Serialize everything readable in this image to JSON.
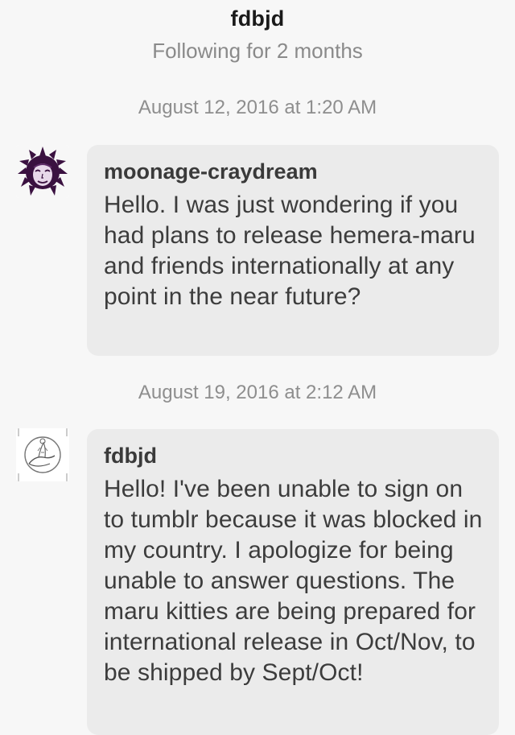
{
  "header": {
    "title": "fdbjd",
    "subtitle": "Following for 2 months"
  },
  "conversation": [
    {
      "timestamp": "August 12, 2016 at 1:20 AM",
      "sender": "moonage-craydream",
      "avatar_icon": "purple-sun-face-avatar",
      "message": "Hello. I was just wondering if you had plans to release hemera-maru and friends internationally at any point in the near future?"
    },
    {
      "timestamp": "August 19, 2016 at 2:12 AM",
      "sender": "fdbjd",
      "avatar_icon": "hand-with-doll-sketch-avatar",
      "message": "Hello! I've been unable to sign on to tumblr because it was blocked in my country. I apologize for being unable to answer questions. The maru kitties are being prepared for international release in Oct/Nov, to be shipped by Sept/Oct!"
    }
  ],
  "colors": {
    "background": "#f7f7f7",
    "bubble": "#ebebeb",
    "text": "#3c3c3c",
    "muted": "#8e8e8e",
    "avatar_purple": "#3a1140"
  }
}
